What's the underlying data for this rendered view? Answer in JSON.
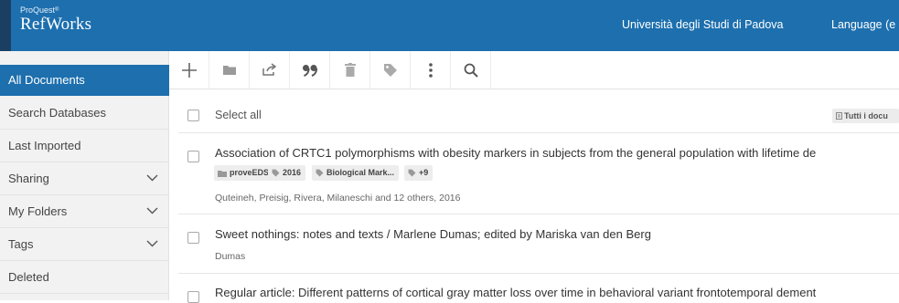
{
  "header": {
    "brand_top": "ProQuest",
    "brand_sup": "®",
    "brand_name": "RefWorks",
    "institution": "Università degli Studi di Padova",
    "language": "Language (e"
  },
  "sidebar": {
    "items": [
      {
        "label": "All Documents"
      },
      {
        "label": "Search Databases"
      },
      {
        "label": "Last Imported"
      },
      {
        "label": "Sharing"
      },
      {
        "label": "My Folders"
      },
      {
        "label": "Tags"
      },
      {
        "label": "Deleted"
      }
    ]
  },
  "toolbar": {
    "icons": [
      "plus-icon",
      "folder-icon",
      "share-icon",
      "quote-icon",
      "trash-icon",
      "tag-icon",
      "more-vertical-icon",
      "search-icon"
    ]
  },
  "list": {
    "select_all": "Select all",
    "sort_label": "Tutti i docu",
    "documents": [
      {
        "title": "Association of CRTC1 polymorphisms with obesity markers in subjects from the general population with lifetime de",
        "tags": [
          {
            "icon": "folder-icon",
            "label": "proveEDS"
          },
          {
            "icon": "tag-icon",
            "label": "2016"
          },
          {
            "icon": "tag-icon",
            "label": "Biological Mark..."
          },
          {
            "icon": "tag-icon",
            "label": "+9"
          }
        ],
        "authors": "Quteineh, Preisig, Rivera, Milaneschi and 12 others, 2016"
      },
      {
        "title": "Sweet nothings: notes and texts / Marlene Dumas; edited by Mariska van den Berg",
        "authors": "Dumas"
      },
      {
        "title": "Regular article: Different patterns of cortical gray matter loss over time in behavioral variant frontotemporal dement",
        "authors": ""
      }
    ]
  },
  "colors": {
    "brand_blue": "#1d6fae",
    "brand_dark": "#1a3f63",
    "sidebar_bg": "#f2f2f2"
  }
}
